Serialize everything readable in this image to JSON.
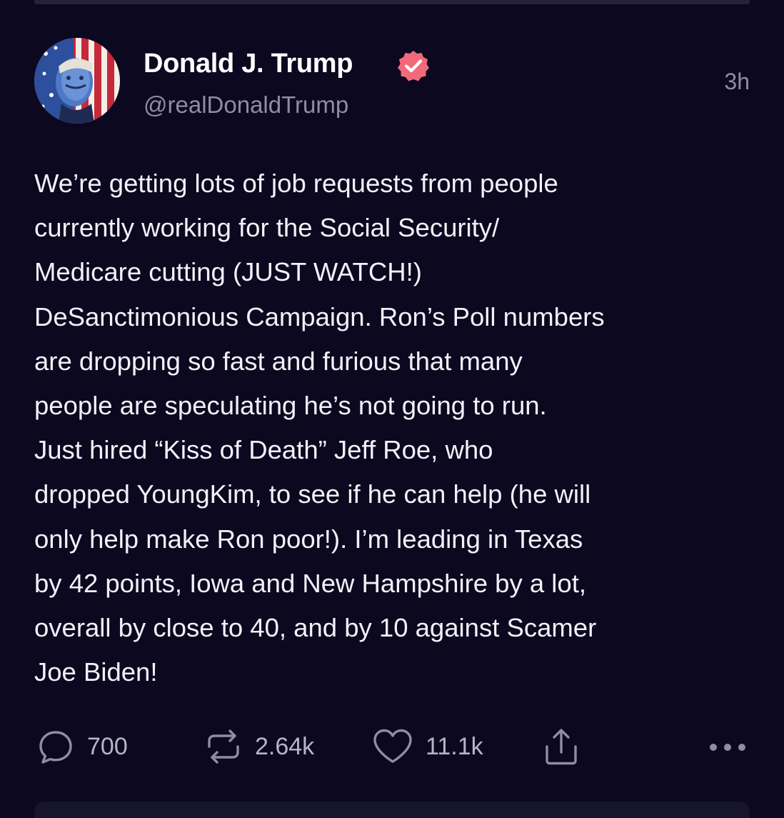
{
  "post": {
    "display_name": "Donald J. Trump",
    "handle": "@realDonaldTrump",
    "timestamp": "3h",
    "verified": true,
    "avatar_icon": "user-avatar",
    "body_lines": [
      "We’re getting lots of job requests from people",
      "currently working for the Social Security/",
      "Medicare cutting (JUST WATCH!)",
      "DeSanctimonious Campaign. Ron’s Poll numbers",
      "are dropping so fast and furious that many",
      "people are speculating he’s not going to run.",
      "Just hired “Kiss of Death” Jeff Roe, who",
      "dropped YoungKim, to see if he can help (he will",
      "only help make Ron poor!). I’m leading in Texas",
      "by 42 points, Iowa and New Hampshire by a lot,",
      "overall by close to 40, and by 10 against Scamer",
      "Joe Biden!"
    ]
  },
  "actions": {
    "replies": "700",
    "reposts": "2.64k",
    "likes": "11.1k",
    "reply_icon": "reply-icon",
    "repost_icon": "repost-icon",
    "like_icon": "heart-icon",
    "share_icon": "share-icon",
    "more_icon": "more-icon"
  },
  "colors": {
    "background": "#0b0820",
    "verified_badge": "#f06a7b",
    "muted_text": "#8f8ca3"
  }
}
